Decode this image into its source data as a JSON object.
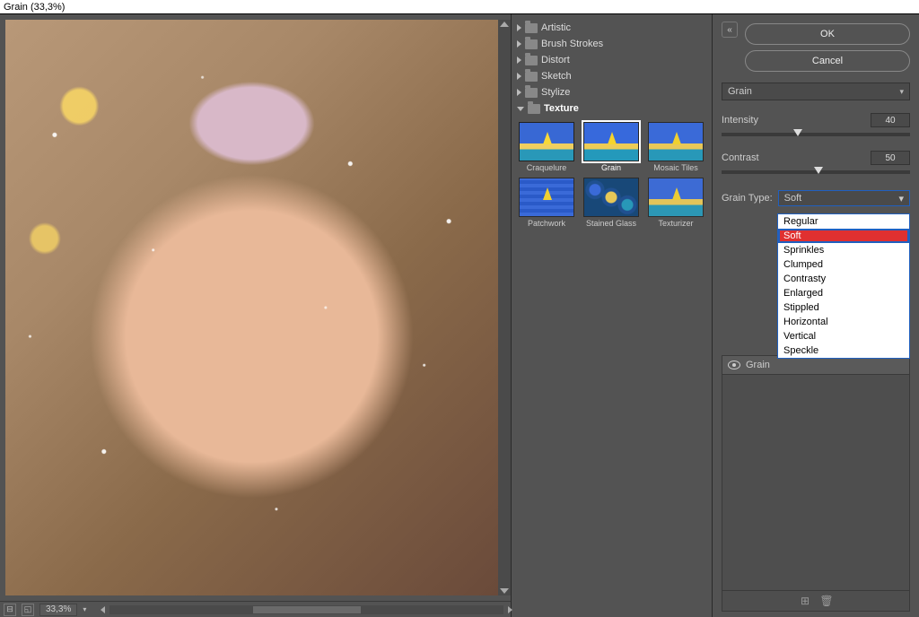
{
  "title": "Grain (33,3%)",
  "zoom": "33,3%",
  "buttons": {
    "ok": "OK",
    "cancel": "Cancel"
  },
  "categories": [
    {
      "label": "Artistic",
      "open": false
    },
    {
      "label": "Brush Strokes",
      "open": false
    },
    {
      "label": "Distort",
      "open": false
    },
    {
      "label": "Sketch",
      "open": false
    },
    {
      "label": "Stylize",
      "open": false
    },
    {
      "label": "Texture",
      "open": true
    }
  ],
  "texture_thumbs": [
    {
      "label": "Craquelure",
      "cls": "t-craq"
    },
    {
      "label": "Grain",
      "cls": "t-grain",
      "selected": true
    },
    {
      "label": "Mosaic Tiles",
      "cls": "t-mosaic"
    },
    {
      "label": "Patchwork",
      "cls": "t-patch"
    },
    {
      "label": "Stained Glass",
      "cls": "t-glass"
    },
    {
      "label": "Texturizer",
      "cls": "t-text"
    }
  ],
  "current_filter": "Grain",
  "params": {
    "intensity_label": "Intensity",
    "intensity_value": "40",
    "contrast_label": "Contrast",
    "contrast_value": "50"
  },
  "grain_type": {
    "label": "Grain Type:",
    "selected": "Soft",
    "options": [
      "Regular",
      "Soft",
      "Sprinkles",
      "Clumped",
      "Contrasty",
      "Enlarged",
      "Stippled",
      "Horizontal",
      "Vertical",
      "Speckle"
    ]
  },
  "layer_name": "Grain"
}
